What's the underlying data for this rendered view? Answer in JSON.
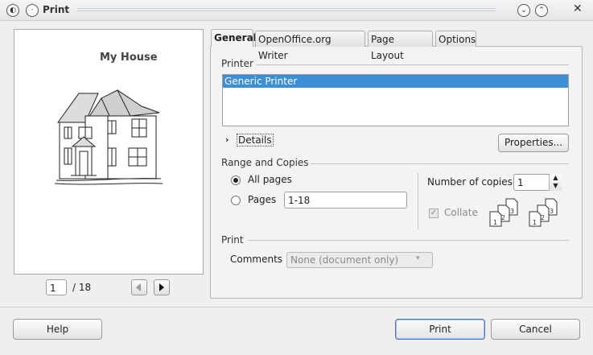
{
  "window": {
    "title": "Print",
    "icons": {
      "app": "app-menu-icon",
      "pin": "pin-icon",
      "minimize": "chevron-down-icon",
      "maximize": "chevron-up-icon",
      "close": "close-icon"
    }
  },
  "preview": {
    "heading": "My House",
    "current_page": "1",
    "total_pages": "/ 18"
  },
  "tabs": [
    {
      "label": "General",
      "active": true
    },
    {
      "label": "OpenOffice.org Writer",
      "active": false
    },
    {
      "label": "Page Layout",
      "active": false
    },
    {
      "label": "Options",
      "active": false
    }
  ],
  "printer": {
    "section_label": "Printer",
    "items": [
      "Generic Printer"
    ],
    "selected": "Generic Printer",
    "details_label": "Details",
    "properties_label": "Properties..."
  },
  "range": {
    "section_label": "Range and Copies",
    "all_pages_label": "All pages",
    "pages_label": "Pages",
    "pages_value": "1-18",
    "copies_label": "Number of copies",
    "copies_value": "1",
    "collate_label": "Collate",
    "collate_checked": true
  },
  "print_section": {
    "section_label": "Print",
    "comments_label": "Comments",
    "comments_value": "None (document only)"
  },
  "buttons": {
    "help": "Help",
    "print": "Print",
    "cancel": "Cancel"
  }
}
